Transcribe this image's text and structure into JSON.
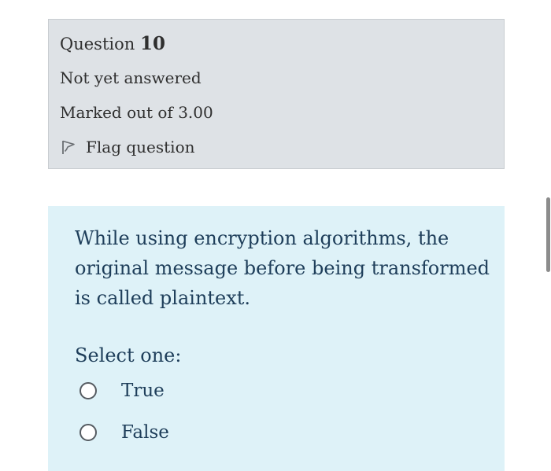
{
  "question_info": {
    "label": "Question",
    "number": "10",
    "state": "Not yet answered",
    "grade": "Marked out of 3.00",
    "flag_label": "Flag question",
    "flag_icon": "flag-icon"
  },
  "question": {
    "text": "While using encryption algorithms, the original message before being transformed is called plaintext.",
    "prompt": "Select one:",
    "options": [
      {
        "label": "True",
        "selected": false
      },
      {
        "label": "False",
        "selected": false
      }
    ]
  },
  "colors": {
    "info_background": "#dee2e6",
    "content_background": "#def2f8",
    "text_dark": "#1e3e5a"
  }
}
